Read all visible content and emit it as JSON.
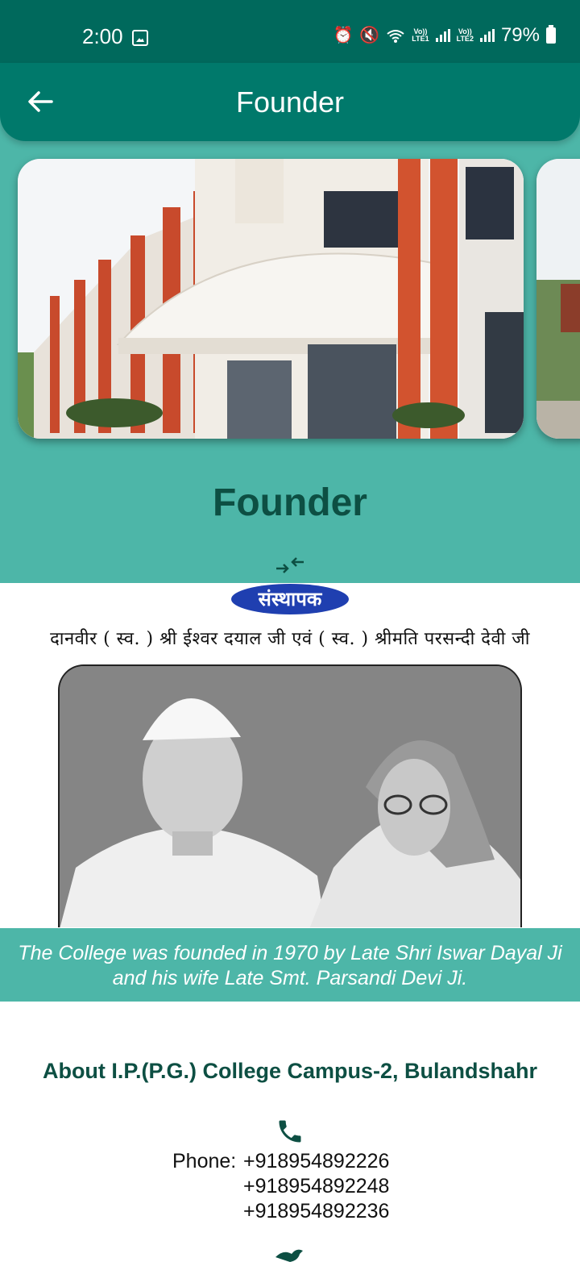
{
  "status_bar": {
    "time": "2:00",
    "lte1": "Vo))\nLTE1",
    "lte2": "Vo))\nLTE2",
    "battery": "79%"
  },
  "app_bar": {
    "title": "Founder"
  },
  "section": {
    "title": "Founder"
  },
  "founder": {
    "badge": "संस्थापक",
    "hindi_names": "दानवीर ( स्व. ) श्री ईश्वर दयाल जी एवं ( स्व. ) श्रीमति परसन्दी देवी जी",
    "caption": "The College was founded in 1970 by Late Shri Iswar Dayal Ji and his wife Late Smt. Parsandi Devi Ji."
  },
  "about": {
    "title": "About I.P.(P.G.) College Campus-2, Bulandshahr",
    "phone_label": "Phone:",
    "phones": [
      "+918954892226",
      "+918954892248",
      "+918954892236"
    ]
  },
  "colors": {
    "status_bar": "#00695c",
    "app_bar": "#00796b",
    "teal": "#4db6a8",
    "dark_green": "#0d4f43"
  },
  "icons": {
    "back": "arrow-left-icon",
    "collapse": "collapse-arrows-icon",
    "phone": "phone-icon",
    "social": "twitter-icon"
  }
}
